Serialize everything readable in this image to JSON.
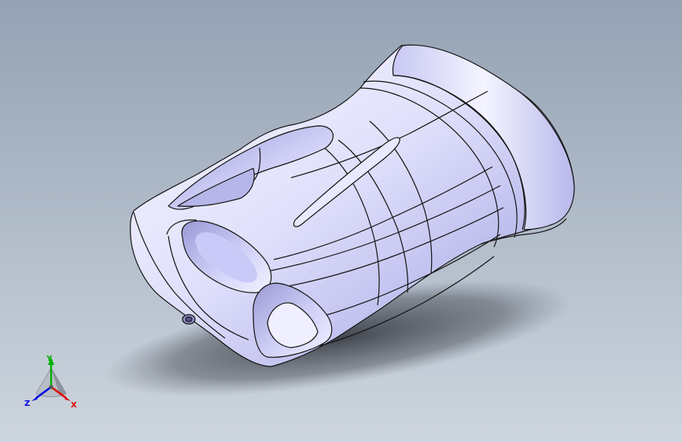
{
  "viewport": {
    "background_top": "#94a2b4",
    "background_bottom": "#cdd5de"
  },
  "model": {
    "surface_color": "#dcdcff",
    "highlight_color": "#fafaff",
    "shadow_color": "#8a8ac8",
    "edge_color": "#141414"
  },
  "triad": {
    "y_label": "Y",
    "x_label": "X",
    "z_label": "Z",
    "y_color": "#00b000",
    "x_color": "#e00000",
    "z_color": "#0000e0"
  }
}
